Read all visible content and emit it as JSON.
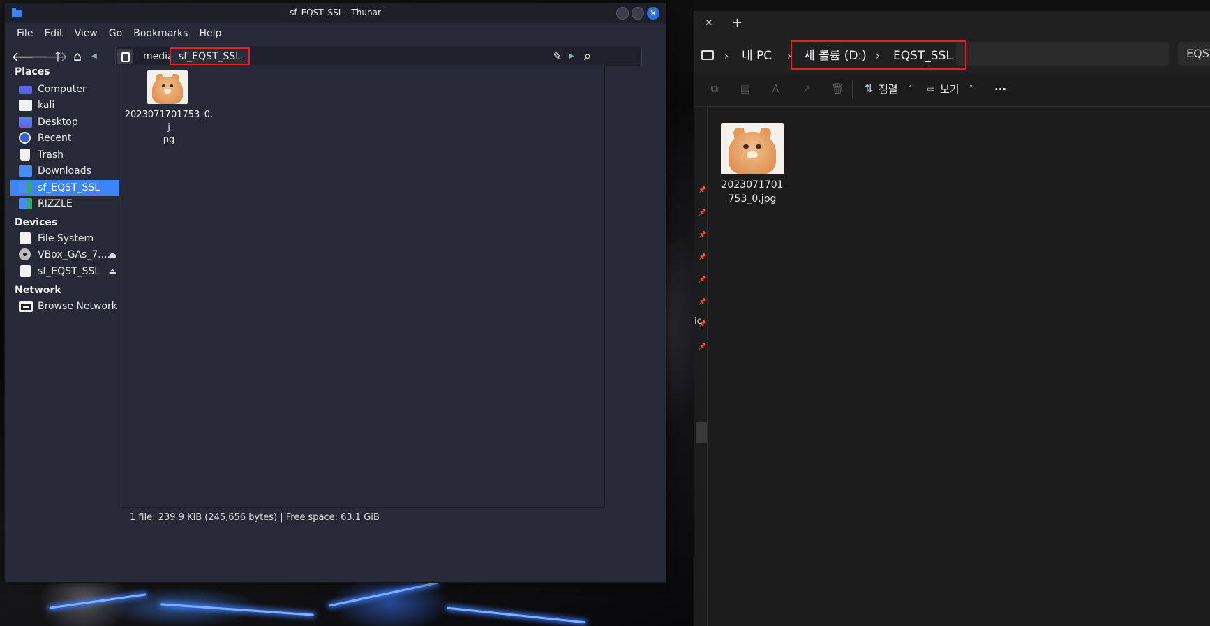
{
  "thunar": {
    "title": "sf_EQST_SSL - Thunar",
    "menu": [
      "File",
      "Edit",
      "View",
      "Go",
      "Bookmarks",
      "Help"
    ],
    "path": {
      "parent": "media",
      "current": "sf_EQST_SSL"
    },
    "sidebar": {
      "places_heading": "Places",
      "places": [
        {
          "label": "Computer",
          "icon": "computer-icon"
        },
        {
          "label": "kali",
          "icon": "home-folder-icon"
        },
        {
          "label": "Desktop",
          "icon": "desktop-folder-icon"
        },
        {
          "label": "Recent",
          "icon": "recent-icon"
        },
        {
          "label": "Trash",
          "icon": "trash-icon"
        },
        {
          "label": "Downloads",
          "icon": "downloads-folder-icon"
        },
        {
          "label": "sf_EQST_SSL",
          "icon": "shared-folder-icon",
          "selected": true
        },
        {
          "label": "RIZZLE",
          "icon": "shared-folder-icon"
        }
      ],
      "devices_heading": "Devices",
      "devices": [
        {
          "label": "File System",
          "icon": "drive-icon"
        },
        {
          "label": "VBox_GAs_7....",
          "icon": "optical-disc-icon",
          "eject": true
        },
        {
          "label": "sf_EQST_SSL",
          "icon": "network-drive-icon",
          "eject": true
        }
      ],
      "network_heading": "Network",
      "network": [
        {
          "label": "Browse Network",
          "icon": "network-icon"
        }
      ]
    },
    "files": [
      {
        "name": "2023071701753_0.jpg",
        "line1": "2023071701753_0.j",
        "line2": "pg"
      }
    ],
    "status": "1 file: 239.9 KiB (245,656 bytes)  |  Free space: 63.1 GiB"
  },
  "explorer": {
    "tab_close": "✕",
    "tab_add": "+",
    "address": {
      "pc": "내 PC",
      "volume": "새 볼륨 (D:)",
      "folder": "EQST_SSL"
    },
    "search_placeholder": "EQST",
    "commands": {
      "sort": "정렬",
      "view": "보기",
      "more": "···"
    },
    "nav_fragment": "ic",
    "files": [
      {
        "name": "2023071701753_0.jpg",
        "line1": "2023071701",
        "line2": "753_0.jpg"
      }
    ]
  },
  "colors": {
    "thunar_bg": "#262a36",
    "selection": "#3d84f7",
    "highlight_box": "#e0232a",
    "explorer_bg": "#1c1c1c"
  }
}
